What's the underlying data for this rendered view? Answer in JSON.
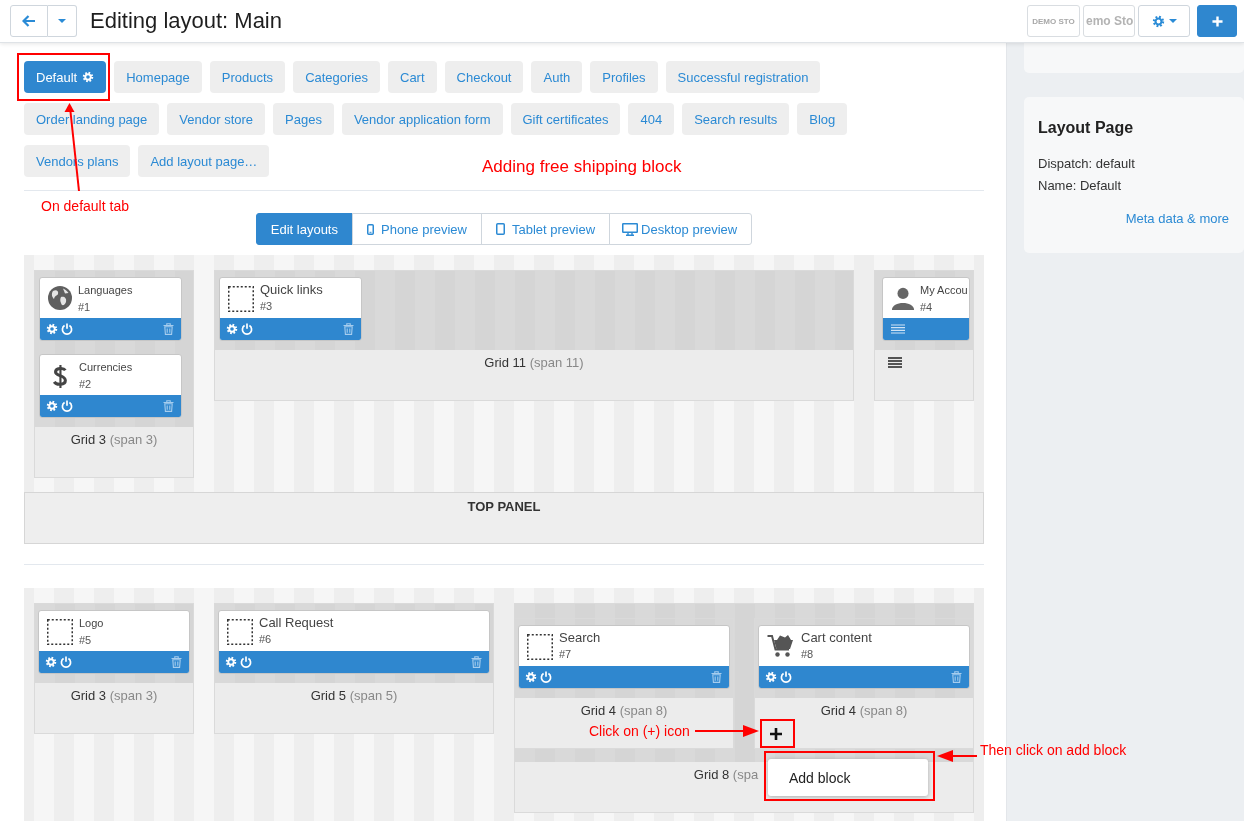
{
  "header": {
    "title": "Editing layout: Main",
    "storefronts": [
      "DEMO STO",
      "emo Sto"
    ]
  },
  "tabs": [
    {
      "label": "Default",
      "selected": true
    },
    {
      "label": "Homepage",
      "selected": false
    },
    {
      "label": "Products",
      "selected": false
    },
    {
      "label": "Categories",
      "selected": false
    },
    {
      "label": "Cart",
      "selected": false
    },
    {
      "label": "Checkout",
      "selected": false
    },
    {
      "label": "Auth",
      "selected": false
    },
    {
      "label": "Profiles",
      "selected": false
    },
    {
      "label": "Successful registration",
      "selected": false
    },
    {
      "label": "Order landing page",
      "selected": false
    },
    {
      "label": "Vendor store",
      "selected": false
    },
    {
      "label": "Pages",
      "selected": false
    },
    {
      "label": "Vendor application form",
      "selected": false
    },
    {
      "label": "Gift certificates",
      "selected": false
    },
    {
      "label": "404",
      "selected": false
    },
    {
      "label": "Search results",
      "selected": false
    },
    {
      "label": "Blog",
      "selected": false
    },
    {
      "label": "Vendors plans",
      "selected": false
    },
    {
      "label": "Add layout page…",
      "selected": false
    }
  ],
  "view_modes": [
    {
      "label": "Edit layouts",
      "kind": "edit",
      "selected": true
    },
    {
      "label": "Phone preview",
      "kind": "phone",
      "selected": false
    },
    {
      "label": "Tablet preview",
      "kind": "tablet",
      "selected": false
    },
    {
      "label": "Desktop preview",
      "kind": "desktop",
      "selected": false
    }
  ],
  "sections": [
    {
      "panel_label": "TOP PANEL",
      "grids": [
        {
          "kind": "labeled",
          "label": "Grid 3",
          "span": "(span 3)",
          "blocks": [
            {
              "name": "Languages",
              "number": "#1",
              "kind": "languages",
              "compact": false
            },
            {
              "name": "Currencies",
              "number": "#2",
              "kind": "currencies",
              "compact": false
            }
          ]
        },
        {
          "kind": "labeled",
          "label": "Grid 11",
          "span": "(span 11)",
          "blocks": [
            {
              "name": "Quick links",
              "number": "#3",
              "kind": "generic",
              "compact": false
            }
          ]
        },
        {
          "kind": "menu",
          "blocks": [
            {
              "name": "My Accou",
              "number": "#4",
              "kind": "account",
              "compact": true
            }
          ]
        }
      ]
    },
    {
      "grids": [
        {
          "kind": "labeled",
          "label": "Grid 3",
          "span": "(span 3)",
          "blocks": [
            {
              "name": "Logo",
              "number": "#5",
              "kind": "generic",
              "compact": false
            }
          ]
        },
        {
          "kind": "labeled",
          "label": "Grid 5",
          "span": "(span 5)",
          "blocks": [
            {
              "name": "Call Request",
              "number": "#6",
              "kind": "generic",
              "compact": false
            }
          ]
        },
        {
          "kind": "labeled",
          "label": "Grid 8",
          "span": "(spa",
          "grids": [
            {
              "kind": "labeled",
              "label": "Grid 4",
              "span": "(span 8)",
              "blocks": [
                {
                  "name": "Search",
                  "number": "#7",
                  "kind": "generic",
                  "compact": false
                }
              ]
            },
            {
              "kind": "add",
              "label": "Grid 4",
              "span": "(span 8)",
              "menu_items": [
                "Add block"
              ],
              "blocks": [
                {
                  "name": "Cart content",
                  "number": "#8",
                  "kind": "cart",
                  "compact": false
                }
              ]
            }
          ]
        }
      ]
    }
  ],
  "sidebar": {
    "title": "Layout Page",
    "lines": [
      "Dispatch: default",
      "Name: Default"
    ],
    "link": "Meta data & more"
  },
  "annotations": [
    "On default tab",
    "Adding free shipping block",
    "Click on (+) icon",
    "Then click on add block"
  ]
}
